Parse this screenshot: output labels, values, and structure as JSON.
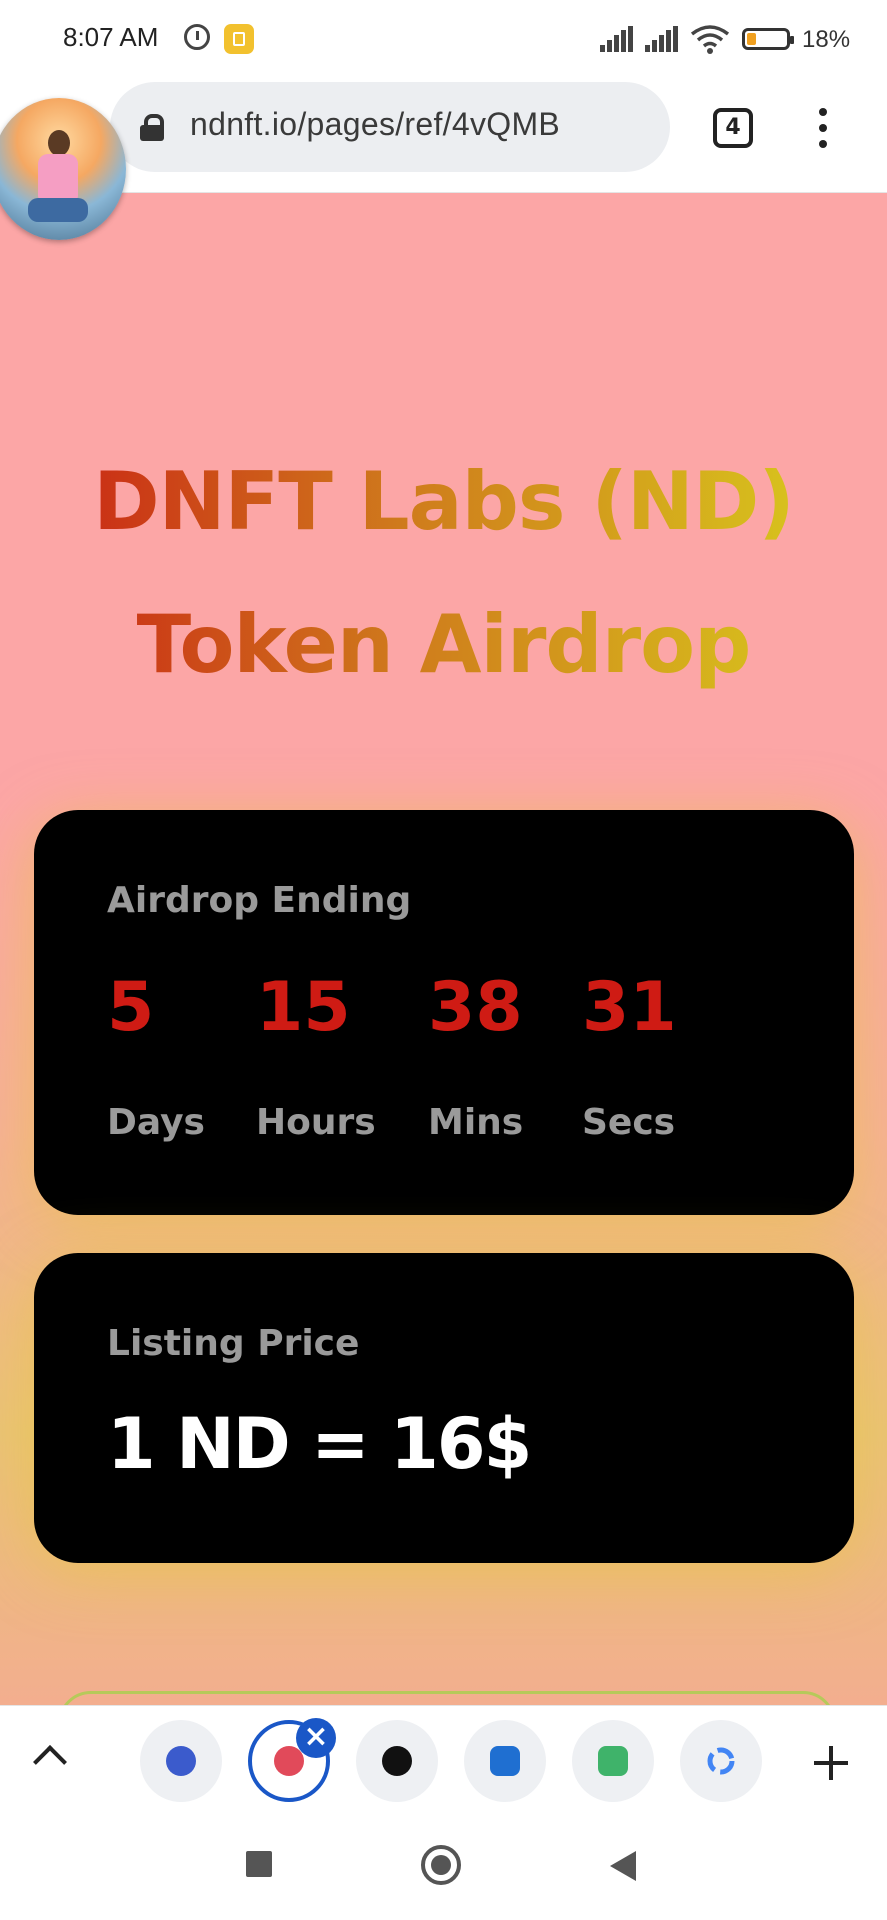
{
  "status_bar": {
    "time": "8:07 AM",
    "battery": "18%"
  },
  "browser": {
    "url": "ndnft.io/pages/ref/4vQMB",
    "tab_count": "4"
  },
  "page": {
    "title_line1": "DNFT Labs (ND)",
    "title_line2": "Token Airdrop",
    "countdown": {
      "label": "Airdrop Ending",
      "days": "5",
      "days_label": "Days",
      "hours": "15",
      "hours_label": "Hours",
      "mins": "38",
      "mins_label": "Mins",
      "secs": "31",
      "secs_label": "Secs"
    },
    "listing": {
      "label": "Listing Price",
      "price": "1 ND = 16$"
    }
  },
  "tab_strip": {
    "tabs": [
      {
        "icon": "shield-app-icon",
        "color": "#3b5bcc"
      },
      {
        "icon": "active-site-icon",
        "color": "#e14a5a"
      },
      {
        "icon": "globe-icon",
        "color": "#111111"
      },
      {
        "icon": "app-icon",
        "color": "#1f6fd1"
      },
      {
        "icon": "gigalife-icon",
        "color": "#3fb36a"
      },
      {
        "icon": "google-icon",
        "color": "#4285f4"
      }
    ]
  },
  "colors": {
    "accent": "#1a57c7",
    "countdown_number": "#cf1b14",
    "page_background": "#fca6a6"
  }
}
